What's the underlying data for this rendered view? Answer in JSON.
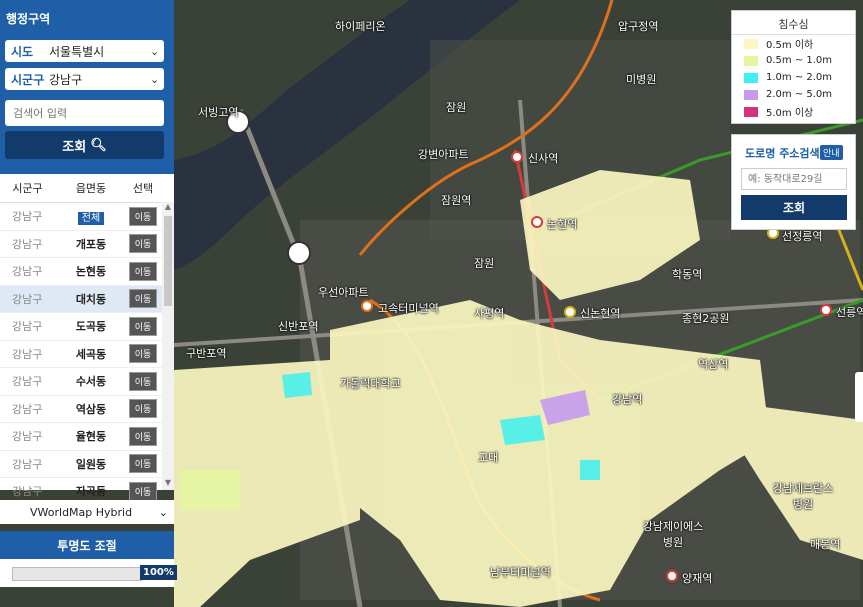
{
  "admin": {
    "title": "행정구역",
    "sido_label": "시도",
    "sido_value": "서울특별시",
    "sigungu_label": "시군구",
    "sigungu_value": "강남구",
    "search_placeholder": "검색어 입력",
    "search_button": "조회"
  },
  "table": {
    "headers": [
      "시군구",
      "읍면동",
      "선택"
    ],
    "rows": [
      {
        "sigungu": "강남구",
        "dong": "전체",
        "action": "이동"
      },
      {
        "sigungu": "강남구",
        "dong": "개포동",
        "action": "이동"
      },
      {
        "sigungu": "강남구",
        "dong": "논현동",
        "action": "이동"
      },
      {
        "sigungu": "강남구",
        "dong": "대치동",
        "action": "이동"
      },
      {
        "sigungu": "강남구",
        "dong": "도곡동",
        "action": "이동"
      },
      {
        "sigungu": "강남구",
        "dong": "세곡동",
        "action": "이동"
      },
      {
        "sigungu": "강남구",
        "dong": "수서동",
        "action": "이동"
      },
      {
        "sigungu": "강남구",
        "dong": "역삼동",
        "action": "이동"
      },
      {
        "sigungu": "강남구",
        "dong": "율현동",
        "action": "이동"
      },
      {
        "sigungu": "강남구",
        "dong": "일원동",
        "action": "이동"
      },
      {
        "sigungu": "강남구",
        "dong": "자곡동",
        "action": "이동"
      }
    ],
    "selected_index": 3
  },
  "basemap": {
    "value": "VWorldMap Hybrid"
  },
  "opacity": {
    "title": "투명도 조절",
    "value_label": "100%",
    "value": 1.0
  },
  "legend": {
    "title": "침수심",
    "items": [
      {
        "label": "0.5m 이하",
        "color": "#fbf7c0"
      },
      {
        "label": "0.5m ~ 1.0m",
        "color": "#e4f7a0"
      },
      {
        "label": "1.0m ~ 2.0m",
        "color": "#3ff0f0"
      },
      {
        "label": "2.0m ~ 5.0m",
        "color": "#c79af0"
      },
      {
        "label": "5.0m 이상",
        "color": "#d4327a"
      }
    ]
  },
  "road_search": {
    "title": "도로명 주소검색",
    "guide": "안내",
    "placeholder": "예: 동작대로29길",
    "button": "조회"
  },
  "map_labels": {
    "hyemyeong": "하이페리온",
    "sewang": "서빙고역",
    "apgujeong": "압구정역",
    "mibyeong": "미병원",
    "jamwon": "잠원",
    "gangbyeon": "강변아파트",
    "sinsa": "신사역",
    "jamwon_st": "잠원역",
    "nonhyeon": "논현역",
    "sinnonhyeon": "신논현역",
    "samwon": "잠원",
    "uson": "우선아파트",
    "gosok": "고속터미널역",
    "sapyeong": "사평역",
    "sinbanpo": "신반포역",
    "gubanpo": "구반포역",
    "gatholic": "가톨릭대학교",
    "gangnam": "강남역",
    "yeoksam": "역삼역",
    "gangnam_severance": "강남세브란스병원",
    "yangjae": "양재역",
    "maebong": "매봉역",
    "nambu": "남부터미널역",
    "seongreung": "선정릉역",
    "seolleung": "선릉역",
    "jamchung": "종현2공원",
    "hakdong": "학동역",
    "gangnam_cheil": "강남제이에스병원",
    "gyodae": "교대",
    "seoul_st": "서울성모병원"
  }
}
